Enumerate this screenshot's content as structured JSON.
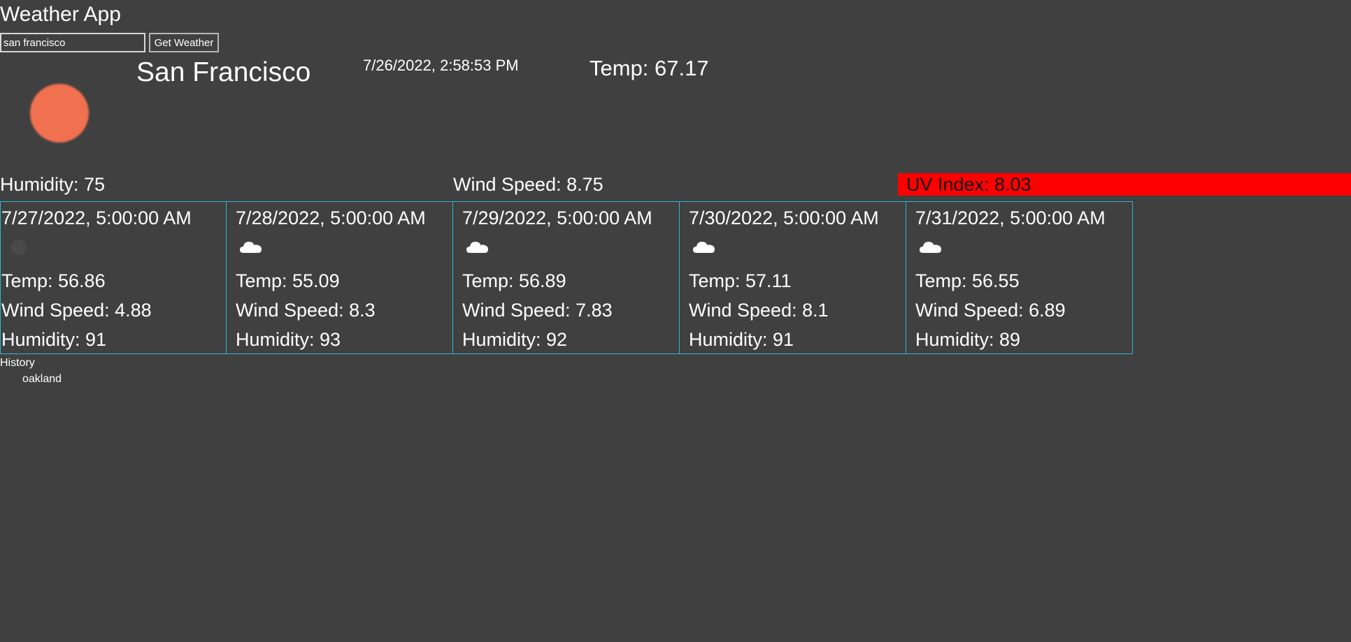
{
  "app": {
    "title": "Weather App"
  },
  "search": {
    "value": "san francisco",
    "button_label": "Get Weather"
  },
  "current": {
    "city": "San Francisco",
    "datetime": "7/26/2022, 2:58:53 PM",
    "temp": "Temp: 67.17",
    "icon": "sun-icon",
    "humidity": "Humidity: 75",
    "wind_speed": "Wind Speed: 8.75",
    "uv_index": "UV Index: 8.03",
    "uv_color": "#ff0000",
    "sun_color": "#f06f50"
  },
  "forecast": [
    {
      "date": "7/27/2022, 5:00:00 AM",
      "icon": "clear-night-icon",
      "temp": "Temp: 56.86",
      "wind": "Wind Speed: 4.88",
      "humidity": "Humidity: 91"
    },
    {
      "date": "7/28/2022, 5:00:00 AM",
      "icon": "cloud-icon",
      "temp": "Temp: 55.09",
      "wind": "Wind Speed: 8.3",
      "humidity": "Humidity: 93"
    },
    {
      "date": "7/29/2022, 5:00:00 AM",
      "icon": "cloud-icon",
      "temp": "Temp: 56.89",
      "wind": "Wind Speed: 7.83",
      "humidity": "Humidity: 92"
    },
    {
      "date": "7/30/2022, 5:00:00 AM",
      "icon": "cloud-icon",
      "temp": "Temp: 57.11",
      "wind": "Wind Speed: 8.1",
      "humidity": "Humidity: 91"
    },
    {
      "date": "7/31/2022, 5:00:00 AM",
      "icon": "cloud-icon",
      "temp": "Temp: 56.55",
      "wind": "Wind Speed: 6.89",
      "humidity": "Humidity: 89"
    }
  ],
  "history": {
    "label": "History",
    "items": [
      "oakland"
    ]
  },
  "colors": {
    "background": "#404040",
    "card_border": "#2bb8d6"
  }
}
